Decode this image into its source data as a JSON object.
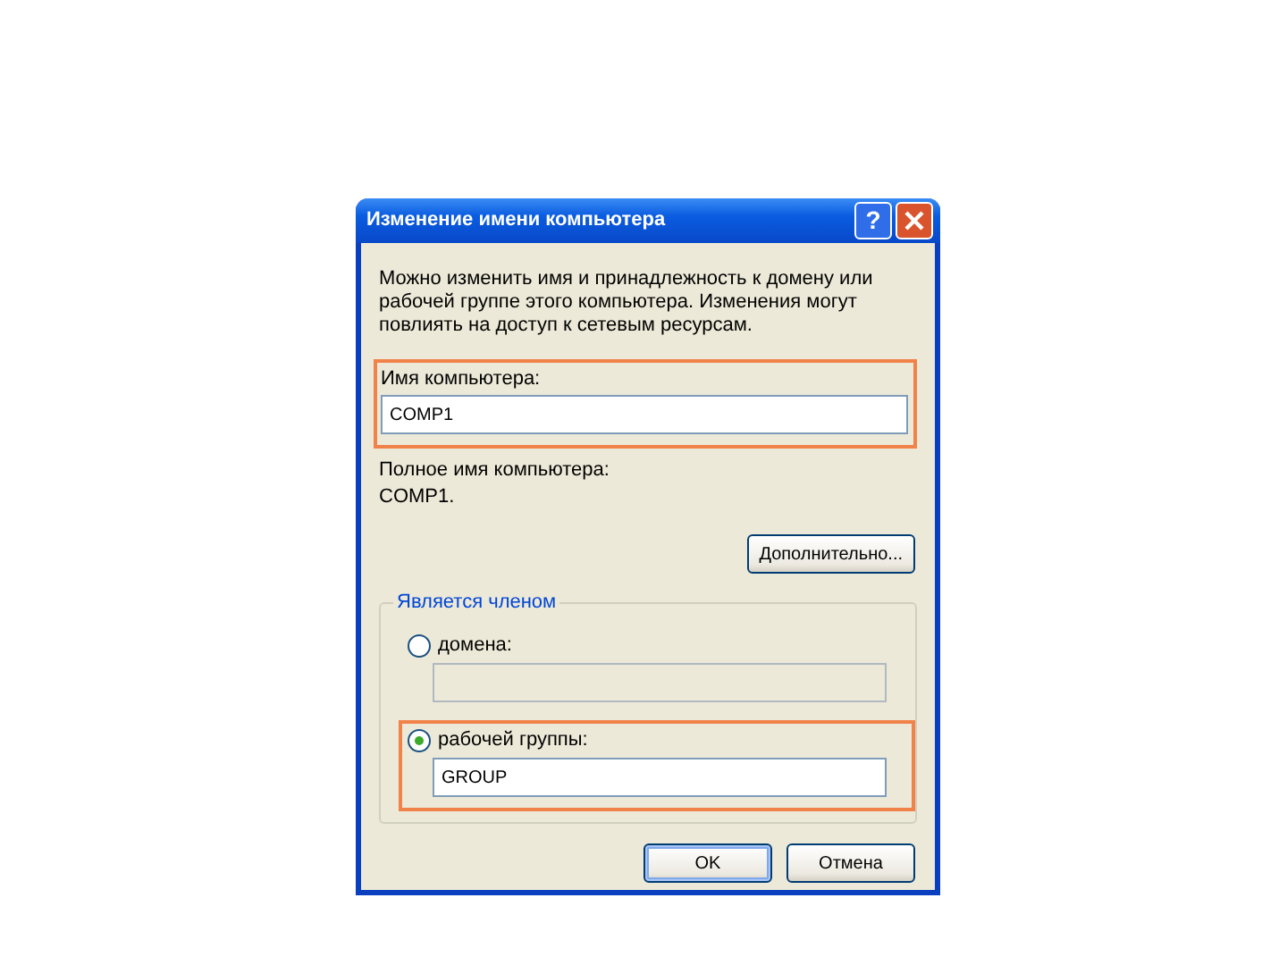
{
  "window": {
    "title": "Изменение имени компьютера",
    "help_button": "?"
  },
  "description": "Можно изменить имя и принадлежность к домену или рабочей группе этого компьютера. Изменения могут повлиять на доступ к сетевым ресурсам.",
  "computer_name": {
    "label": "Имя компьютера:",
    "value": "COMP1",
    "highlighted": true
  },
  "full_name": {
    "label": "Полное имя компьютера:",
    "value": "COMP1."
  },
  "more_button": "Дополнительно...",
  "member_of": {
    "legend": "Является членом",
    "options": [
      {
        "label": "домена:",
        "selected": false,
        "disabled": true,
        "highlighted": false
      },
      {
        "label": "рабочей группы:",
        "value": "GROUP",
        "selected": true,
        "disabled": false,
        "highlighted": true
      }
    ]
  },
  "buttons": [
    {
      "label": "OK",
      "default": true
    },
    {
      "label": "Отмена",
      "default": false
    }
  ]
}
